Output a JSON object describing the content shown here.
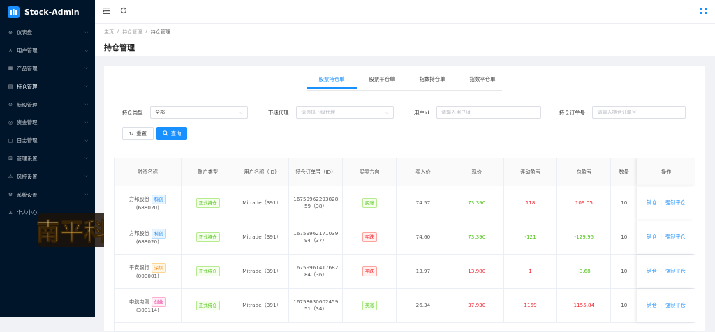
{
  "app": {
    "title": "Stock-Admin",
    "logo_char": "ſ"
  },
  "sidebar": {
    "items": [
      {
        "label": "仪表盘",
        "icon": "dashboard-icon"
      },
      {
        "label": "用户管理",
        "icon": "user-icon"
      },
      {
        "label": "产品管理",
        "icon": "product-icon"
      },
      {
        "label": "持仓管理",
        "icon": "position-icon"
      },
      {
        "label": "新股管理",
        "icon": "ipo-icon"
      },
      {
        "label": "资金管理",
        "icon": "fund-icon"
      },
      {
        "label": "日志管理",
        "icon": "log-icon"
      },
      {
        "label": "管理设置",
        "icon": "admin-settings-icon"
      },
      {
        "label": "风控设置",
        "icon": "risk-icon"
      },
      {
        "label": "系统设置",
        "icon": "system-icon"
      },
      {
        "label": "个人中心",
        "icon": "person-icon"
      }
    ]
  },
  "watermark": {
    "text": "南平科技"
  },
  "breadcrumb": {
    "home": "主页",
    "parent": "持仓管理",
    "current": "持仓管理"
  },
  "page": {
    "title": "持仓管理"
  },
  "tabs": [
    "股票持仓单",
    "股票平仓单",
    "指数持仓单",
    "指数平仓单"
  ],
  "filters": {
    "type_label": "持仓类型:",
    "type_value": "全部",
    "agent_label": "下级代理:",
    "agent_placeholder": "请选择下级代理",
    "userid_label": "用户Id:",
    "userid_placeholder": "请输入用户Id",
    "order_label": "持仓订单号:",
    "order_placeholder": "请输入持仓订单号"
  },
  "buttons": {
    "reset": "重置",
    "query": "查询"
  },
  "table": {
    "headers": [
      "融资名称",
      "账户类型",
      "用户名称（ID）",
      "持仓订单号（ID）",
      "买卖方向",
      "买入价",
      "现价",
      "浮动盈亏",
      "总盈亏",
      "数量",
      "操作"
    ],
    "rows": [
      {
        "name": "方邦股份",
        "board": "科创",
        "code": "(688020)",
        "account": "正式持仓",
        "user": "Mitrade（391）",
        "order1": "16759962293828",
        "order2": "59（38）",
        "dir": "买涨",
        "buy": "74.57",
        "now": "73.390",
        "float": "118",
        "total": "109.05",
        "qty": "10"
      },
      {
        "name": "方邦股份",
        "board": "科创",
        "code": "(688020)",
        "account": "正式持仓",
        "user": "Mitrade（391）",
        "order1": "16759962171039",
        "order2": "94（37）",
        "dir": "买跌",
        "buy": "74.60",
        "now": "73.390",
        "float": "-121",
        "total": "-129.95",
        "qty": "10"
      },
      {
        "name": "平安银行",
        "board": "深圳",
        "code": "(000001)",
        "account": "正式持仓",
        "user": "Mitrade（391）",
        "order1": "16759961417682",
        "order2": "84（36）",
        "dir": "买跌",
        "buy": "13.97",
        "now": "13.980",
        "float": "1",
        "total": "-0.68",
        "qty": "10"
      },
      {
        "name": "中航电测",
        "board": "创业",
        "code": "(300114)",
        "account": "正式持仓",
        "user": "Mitrade（391）",
        "order1": "16758630602459",
        "order2": "51（34）",
        "dir": "买涨",
        "buy": "26.34",
        "now": "37.930",
        "float": "1159",
        "total": "1155.84",
        "qty": "10"
      }
    ],
    "op_close": "销仓",
    "op_force": "强制平仓"
  }
}
